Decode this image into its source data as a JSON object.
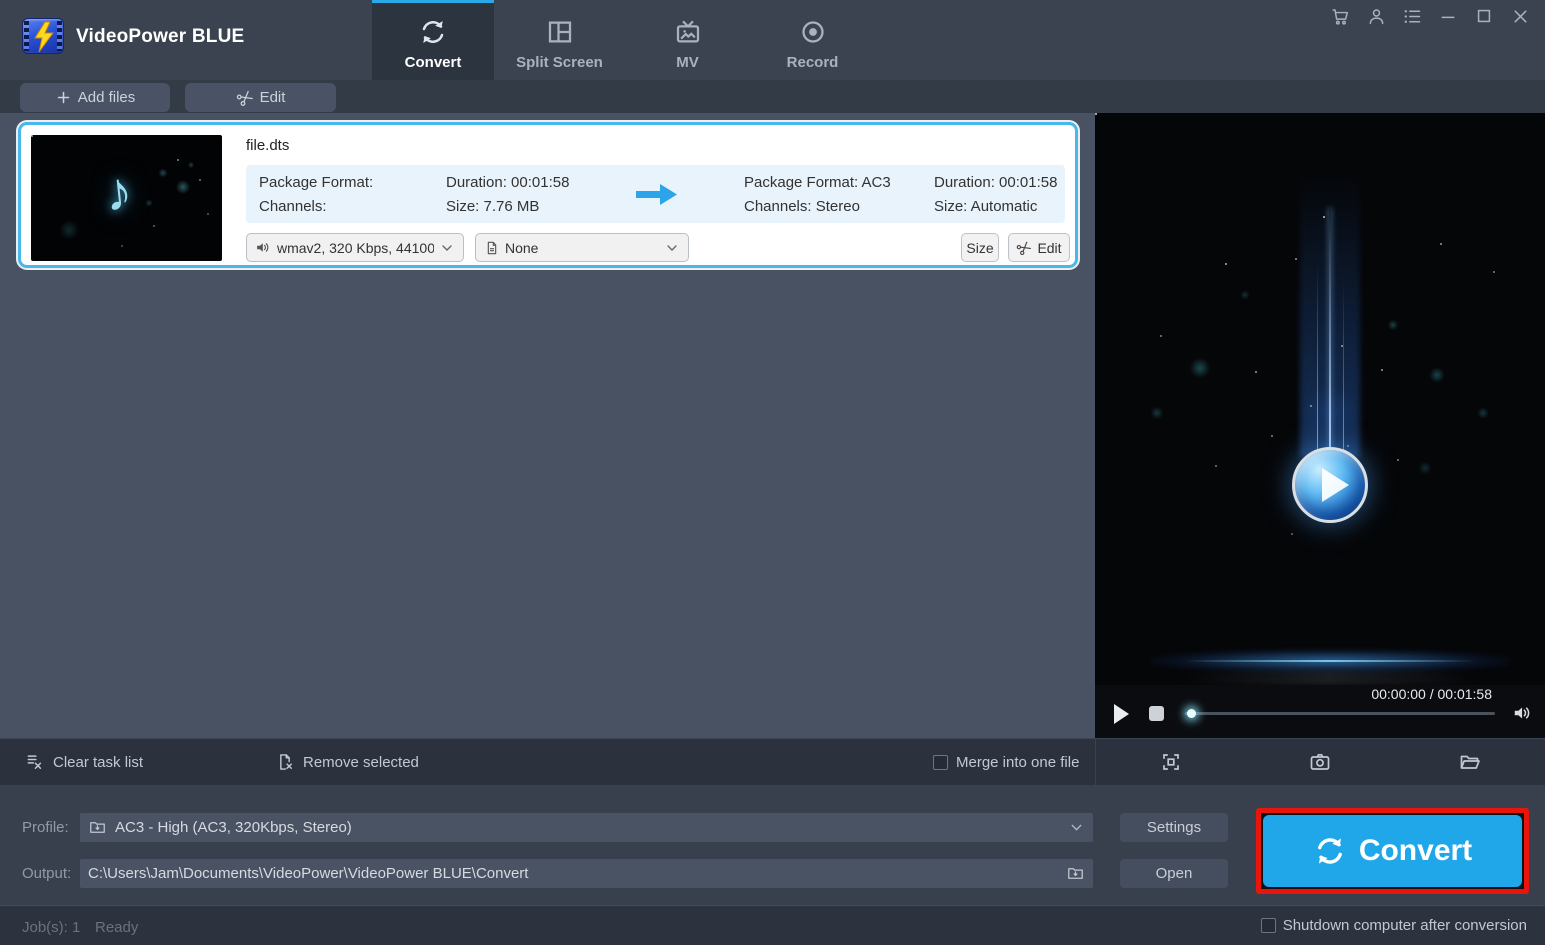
{
  "app": {
    "title": "VideoPower BLUE"
  },
  "tabs": [
    {
      "label": "Convert",
      "icon": "sync-icon",
      "active": true
    },
    {
      "label": "Split Screen",
      "icon": "split-screen-icon",
      "active": false
    },
    {
      "label": "MV",
      "icon": "tv-icon",
      "active": false
    },
    {
      "label": "Record",
      "icon": "record-icon",
      "active": false
    }
  ],
  "toolbar": {
    "add_files_label": "Add files",
    "edit_label": "Edit"
  },
  "file_card": {
    "filename": "file.dts",
    "source": {
      "package_format": "Package Format:",
      "duration": "Duration: 00:01:58",
      "channels": "Channels:",
      "size": "Size: 7.76 MB"
    },
    "target": {
      "package_format": "Package Format: AC3",
      "duration": "Duration: 00:01:58",
      "channels": "Channels: Stereo",
      "size": "Size: Automatic"
    },
    "audio_select": "wmav2, 320 Kbps, 44100 ...",
    "subtitle_select": "None",
    "size_button_label": "Size",
    "edit_button_label": "Edit"
  },
  "preview_panel": {
    "time_display": "00:00:00 / 00:01:58"
  },
  "task_bar": {
    "clear_label": "Clear task list",
    "remove_label": "Remove selected",
    "merge_label": "Merge into one file",
    "merge_checked": false
  },
  "profile_row": {
    "label": "Profile:",
    "value": "AC3 - High (AC3, 320Kbps, Stereo)",
    "settings_label": "Settings"
  },
  "output_row": {
    "label": "Output:",
    "value": "C:\\Users\\Jam\\Documents\\VideoPower\\VideoPower BLUE\\Convert",
    "open_label": "Open"
  },
  "convert": {
    "label": "Convert"
  },
  "status_bar": {
    "jobs": "Job(s): 1",
    "state": "Ready",
    "shutdown_label": "Shutdown computer after conversion",
    "shutdown_checked": false
  },
  "colors": {
    "accent_blue": "#1fa7ea",
    "highlight_red": "#e9150d",
    "card_border": "#48b7ea",
    "info_box_bg": "#e8f3fb",
    "tab_active_line": "#2aa9e6",
    "titlebar_bg": "#3b4351",
    "main_bg": "#495262"
  },
  "note_glyph": "♪"
}
